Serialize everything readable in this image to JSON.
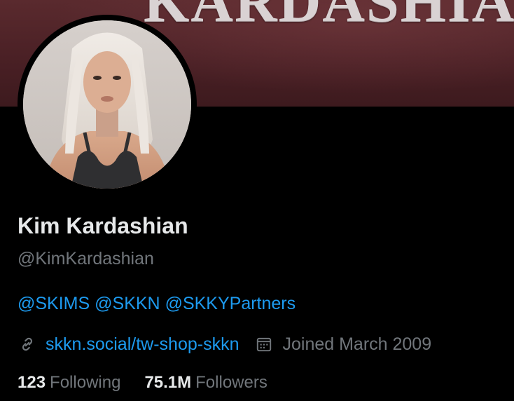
{
  "banner": {
    "word": "KARDASHIAN"
  },
  "profile": {
    "name": "Kim Kardashian",
    "handle": "@KimKardashian",
    "bio_mentions": [
      "@SKIMS",
      "@SKKN",
      "@SKKYPartners"
    ],
    "website": "skkn.social/tw-shop-skkn",
    "joined": "Joined March 2009",
    "following_count": "123",
    "following_label": "Following",
    "followers_count": "75.1M",
    "followers_label": "Followers"
  },
  "icons": {
    "website": "link-icon",
    "joined": "calendar-icon"
  },
  "colors": {
    "background": "#000000",
    "accent": "#1d9bf0",
    "primary_text": "#e7e9ea",
    "secondary_text": "#71767b",
    "banner": "#4a2025"
  }
}
